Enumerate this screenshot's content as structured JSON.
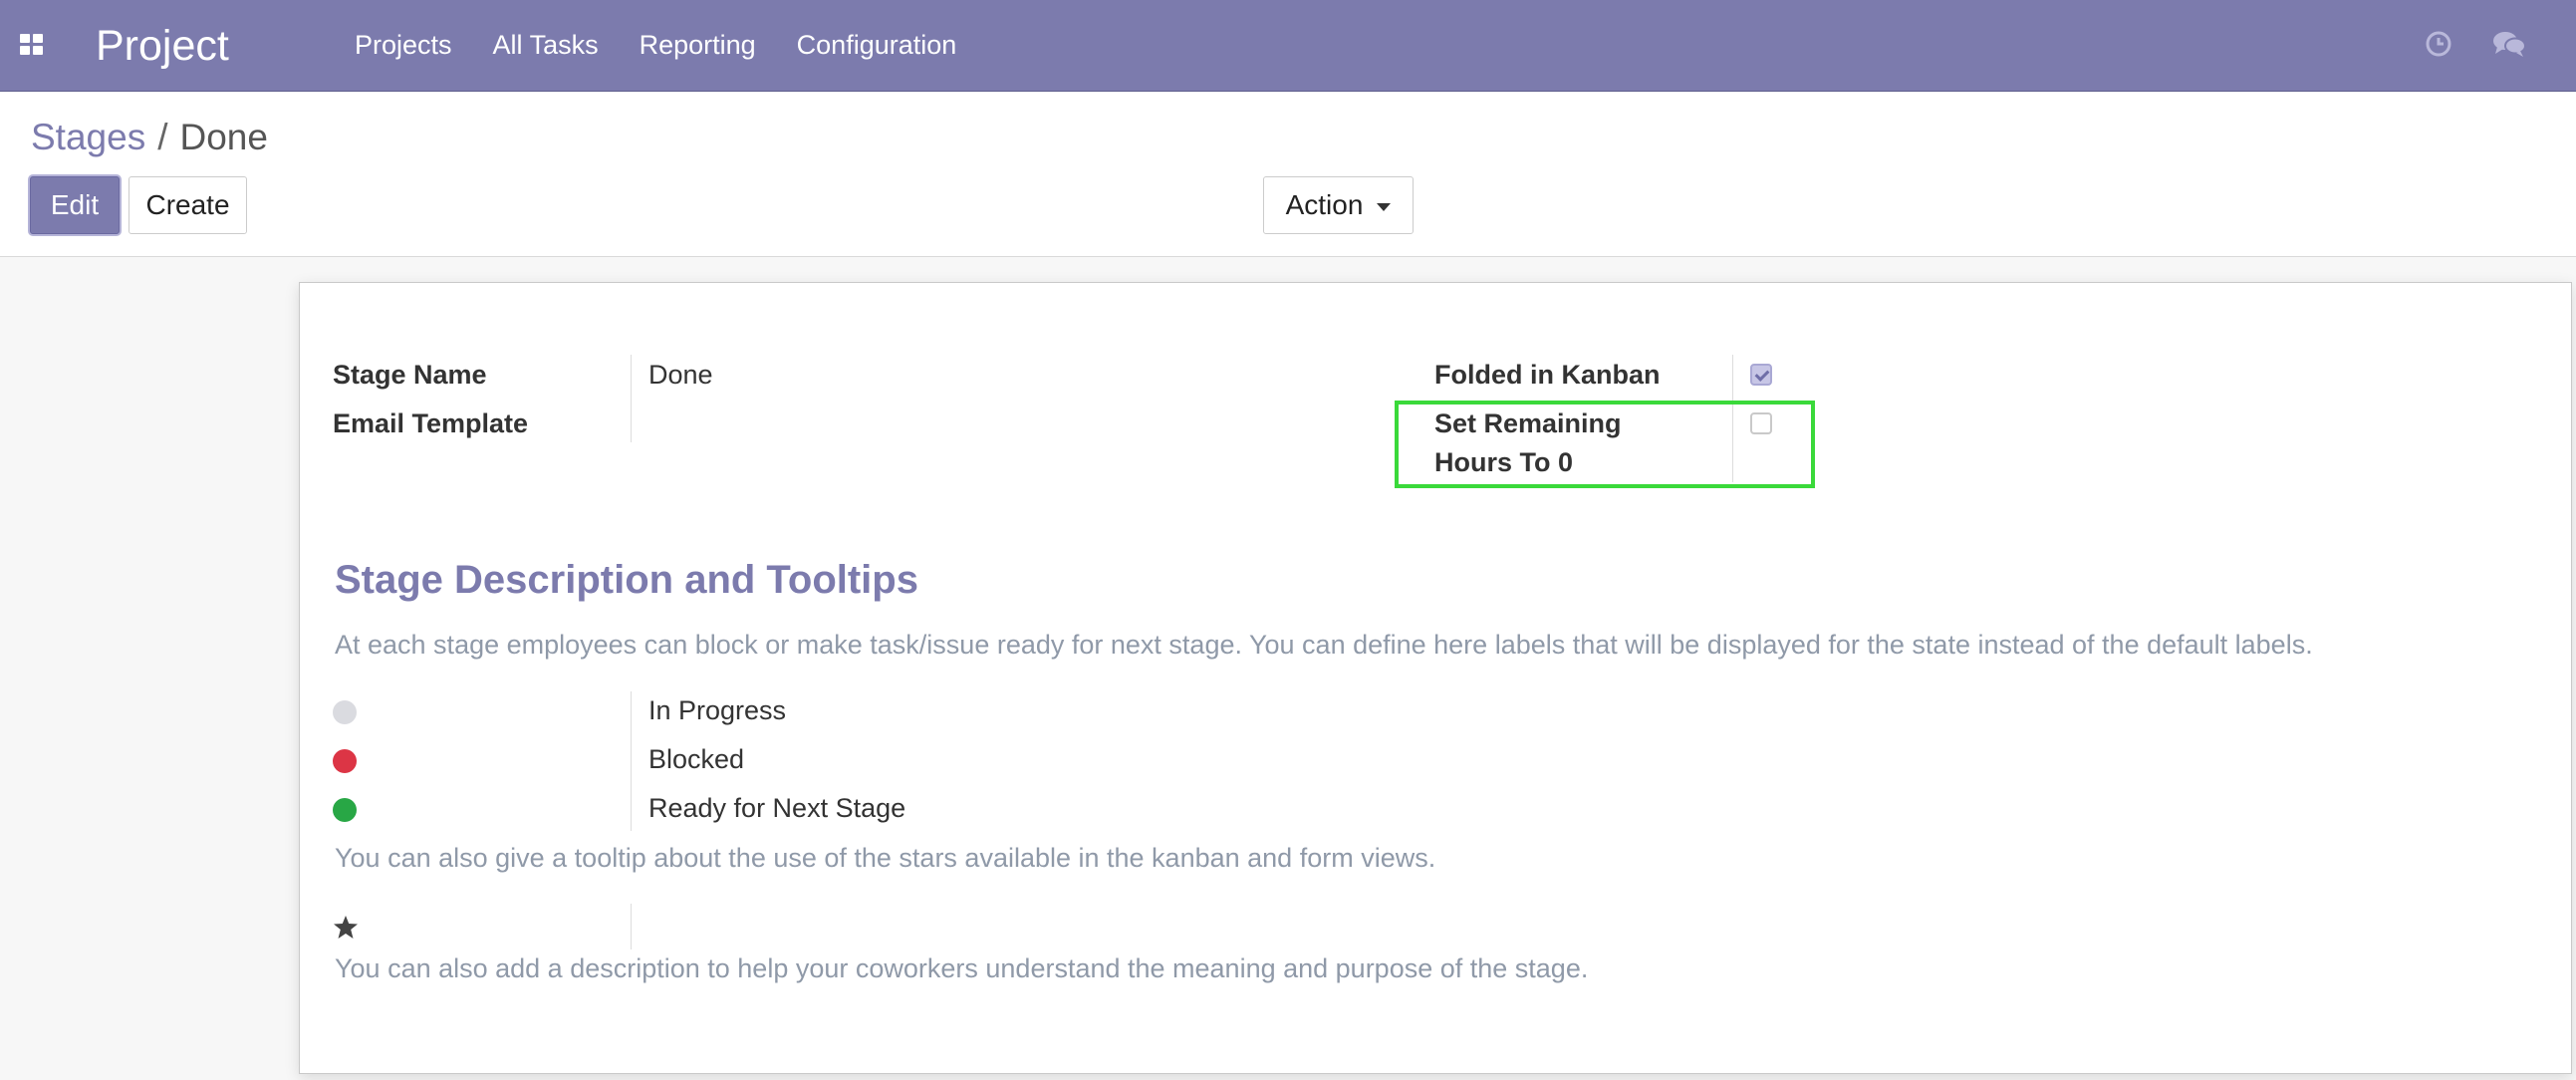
{
  "navbar": {
    "brand": "Project",
    "menu": [
      "Projects",
      "All Tasks",
      "Reporting",
      "Configuration"
    ],
    "color": "#7c7bad"
  },
  "breadcrumb": {
    "parent": "Stages",
    "separator": "/",
    "current": "Done"
  },
  "buttons": {
    "edit": "Edit",
    "create": "Create",
    "action": "Action"
  },
  "form": {
    "stage_name_label": "Stage Name",
    "stage_name_value": "Done",
    "email_template_label": "Email Template",
    "folded_label": "Folded in Kanban",
    "folded_checked": true,
    "set_remaining_label_line1": "Set Remaining",
    "set_remaining_label_line2": "Hours To 0",
    "set_remaining_checked": false
  },
  "section": {
    "title": "Stage Description and Tooltips",
    "help_states": "At each stage employees can block or make task/issue ready for next stage. You can define here labels that will be displayed for the state instead of the default labels.",
    "states": [
      {
        "label": "In Progress",
        "color": "#dadbe0"
      },
      {
        "label": "Blocked",
        "color": "#dc3545"
      },
      {
        "label": "Ready for Next Stage",
        "color": "#28a745"
      }
    ],
    "help_stars": "You can also give a tooltip about the use of the stars available in the kanban and form views.",
    "help_description": "You can also add a description to help your coworkers understand the meaning and purpose of the stage."
  },
  "icons": [
    "apps-icon",
    "clock-icon",
    "chat-icon",
    "star-icon",
    "caret-down-icon"
  ]
}
